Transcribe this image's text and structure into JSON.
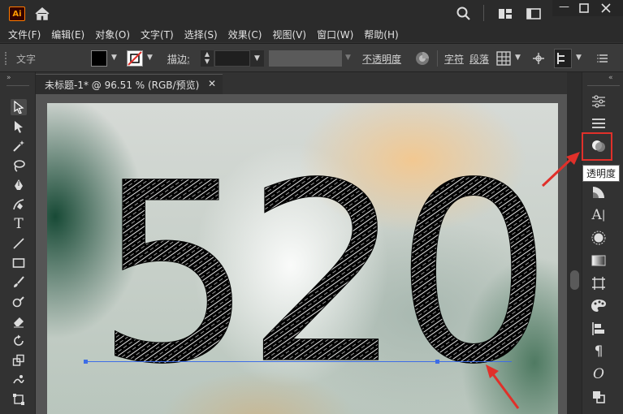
{
  "app": {
    "logo": "Ai"
  },
  "menu": {
    "items": [
      "文件(F)",
      "编辑(E)",
      "对象(O)",
      "文字(T)",
      "选择(S)",
      "效果(C)",
      "视图(V)",
      "窗口(W)",
      "帮助(H)"
    ]
  },
  "control": {
    "type_label": "文字",
    "stroke_label": "描边:",
    "opacity_label": "不透明度",
    "char_label": "字符",
    "para_label": "段落"
  },
  "document": {
    "tab_title": "未标题-1* @ 96.51 % (RGB/预览)"
  },
  "artboard": {
    "text": "520"
  },
  "tooltip": {
    "text": "透明度"
  },
  "colors": {
    "accent_red": "#e0302a",
    "selection_blue": "#3d6de6",
    "ai_orange": "#ff9a00"
  }
}
